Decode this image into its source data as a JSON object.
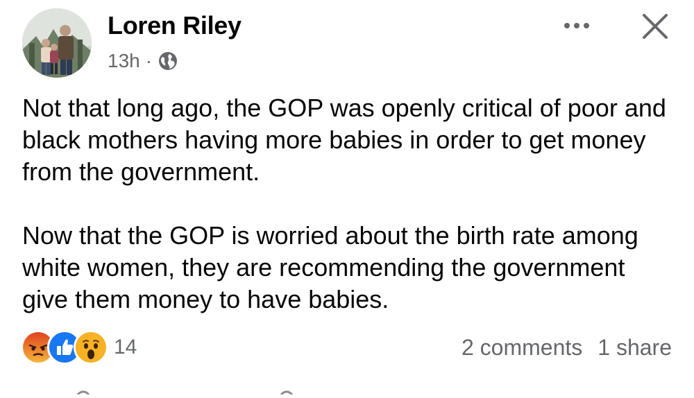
{
  "post": {
    "author": "Loren Riley",
    "time": "13h",
    "separator": "·",
    "privacy_icon": "globe-icon",
    "paragraphs": [
      "Not that long ago, the GOP was openly critical of poor and black mothers having more babies in order to get money from the government.",
      "Now that the GOP is worried about the birth rate among white women, they are recommending the government give them money to have babies."
    ]
  },
  "reactions": {
    "icons": [
      "angry-reaction-icon",
      "like-reaction-icon",
      "wow-reaction-icon"
    ],
    "count": "14"
  },
  "stats": {
    "comments": "2 comments",
    "shares": "1 share"
  },
  "colors": {
    "text": "#050505",
    "secondary": "#65676b",
    "like": "#1877f2",
    "angry": "#e9710f",
    "wow": "#f7b125"
  }
}
